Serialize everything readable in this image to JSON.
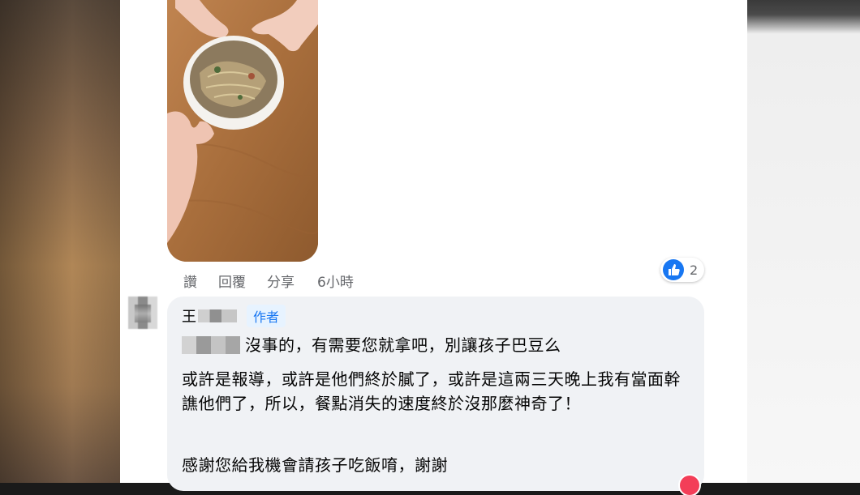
{
  "post": {
    "photo_alt": "noodles-bowl-photo"
  },
  "comment_actions": {
    "like": "讚",
    "reply": "回覆",
    "share": "分享",
    "time": "6小時"
  },
  "reaction": {
    "count": "2",
    "color": "#1877f2"
  },
  "reply": {
    "name_prefix": "王",
    "author_tag": "作者",
    "line1": "沒事的，有需要您就拿吧，別讓孩子巴豆么",
    "para2": "或許是報導，或許是他們終於膩了，或許是這兩三天晚上我有當面幹譙他們了，所以，餐點消失的速度終於沒那麼神奇了！",
    "para3": "感謝您給我機會請孩子吃飯唷，謝謝"
  }
}
